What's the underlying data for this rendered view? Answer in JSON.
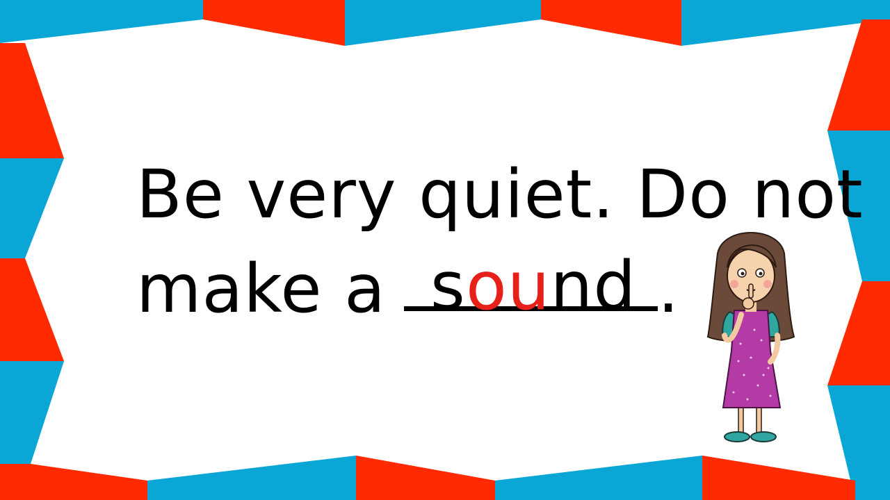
{
  "slide": {
    "line1": "Be very quiet. Do not",
    "line2_prefix": "make a",
    "answer": {
      "before": "s",
      "highlight": "ou",
      "after": "nd"
    },
    "line2_suffix": "."
  },
  "colors": {
    "red": "#ff2a00",
    "blue": "#0aa7d6",
    "highlight": "#e8201a"
  },
  "icons": {
    "character": "girl-shushing-icon"
  }
}
